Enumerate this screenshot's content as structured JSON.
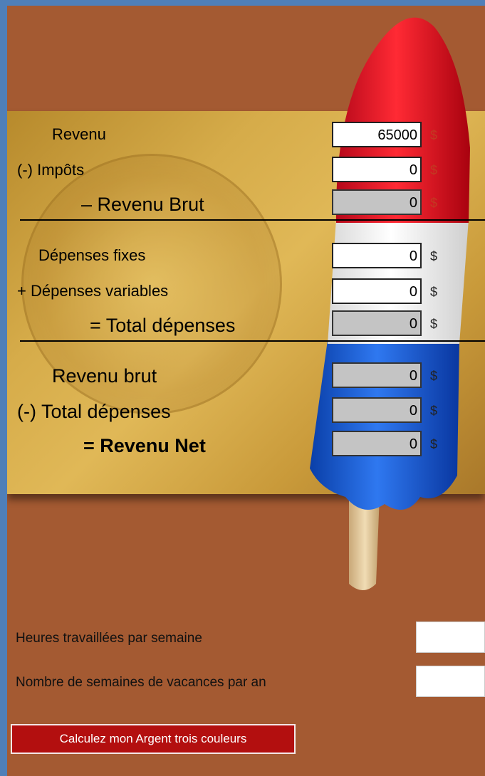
{
  "income": {
    "revenu_label": "Revenu",
    "revenu_value": "65000",
    "impots_label": "(-) Impôts",
    "impots_value": "0",
    "revenu_brut_label": "– Revenu Brut",
    "revenu_brut_value": "0"
  },
  "expenses": {
    "fixes_label": "Dépenses fixes",
    "fixes_value": "0",
    "variables_label": "+ Dépenses variables",
    "variables_value": "0",
    "total_label": "= Total dépenses",
    "total_value": "0"
  },
  "net": {
    "revenu_brut_label": "Revenu brut",
    "revenu_brut_value": "0",
    "total_depenses_label": "(-) Total dépenses",
    "total_depenses_value": "0",
    "revenu_net_label": "= Revenu Net",
    "revenu_net_value": "0"
  },
  "currency": "$",
  "questions": {
    "hours_label": "Heures travaillées par semaine",
    "vacation_label": "Nombre de semaines de vacances par an"
  },
  "calc_button": "Calculez mon Argent trois couleurs",
  "colors": {
    "background": "#a45a32",
    "border": "#4f7fb8",
    "button": "#b30f0f"
  }
}
